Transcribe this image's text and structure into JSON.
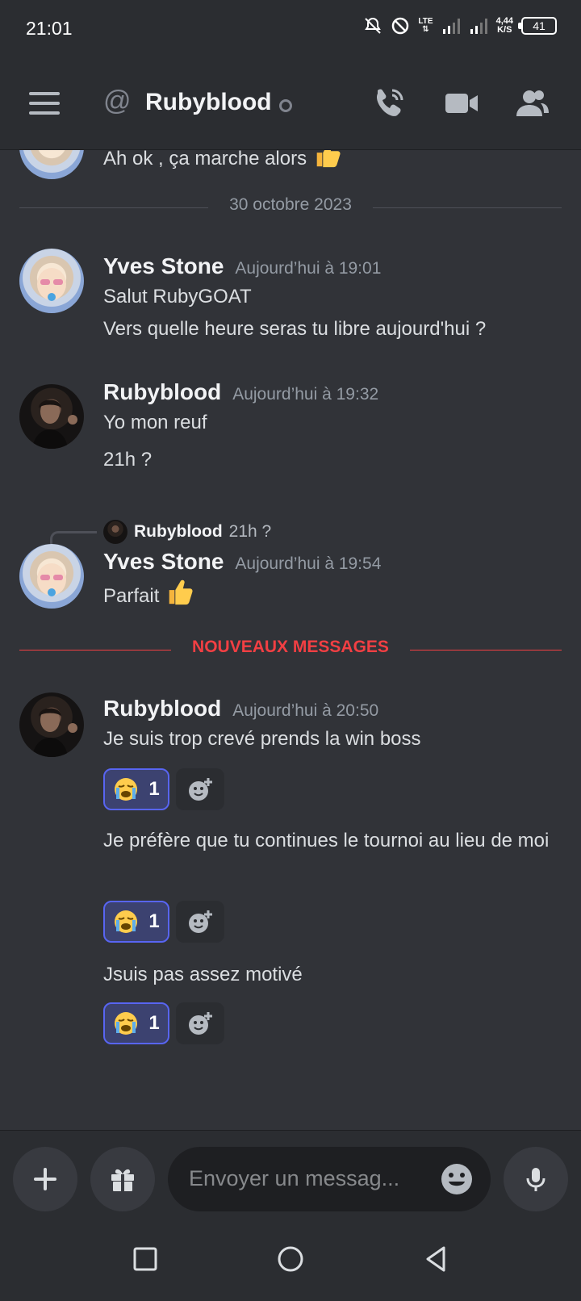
{
  "status_bar": {
    "time": "21:01",
    "network": "LTE",
    "speed_top": "4,44",
    "speed_bottom": "K/S",
    "battery": "41"
  },
  "header": {
    "title": "Rubyblood"
  },
  "previous_message": {
    "text": "Ah ok , ça marche alors"
  },
  "date_divider": "30 octobre 2023",
  "messages": [
    {
      "author": "Yves Stone",
      "time": "Aujourd’hui à 19:01",
      "lines": [
        "Salut RubyGOAT",
        "Vers quelle heure seras tu libre aujourd'hui ?"
      ]
    },
    {
      "author": "Rubyblood",
      "time": "Aujourd’hui à 19:32",
      "lines": [
        "Yo mon reuf",
        "21h ?"
      ]
    },
    {
      "reply_to": {
        "author": "Rubyblood",
        "text": "21h ?"
      },
      "author": "Yves Stone",
      "time": "Aujourd’hui à 19:54",
      "lines": [
        "Parfait"
      ]
    }
  ],
  "new_messages_label": "NOUVEAUX MESSAGES",
  "new_group": {
    "author": "Rubyblood",
    "time": "Aujourd’hui à 20:50",
    "items": [
      {
        "text": "Je suis trop crevé prends la win boss",
        "reaction_count": "1"
      },
      {
        "text": "Je préfère que tu continues le tournoi au lieu de moi",
        "reaction_count": "1"
      },
      {
        "text": "Jsuis pas assez motivé",
        "reaction_count": "1"
      }
    ]
  },
  "input": {
    "placeholder": "Envoyer un messag..."
  },
  "colors": {
    "background": "#313338",
    "header": "#2b2d31",
    "accent": "#5865f2",
    "new_messages": "#f23f43"
  }
}
